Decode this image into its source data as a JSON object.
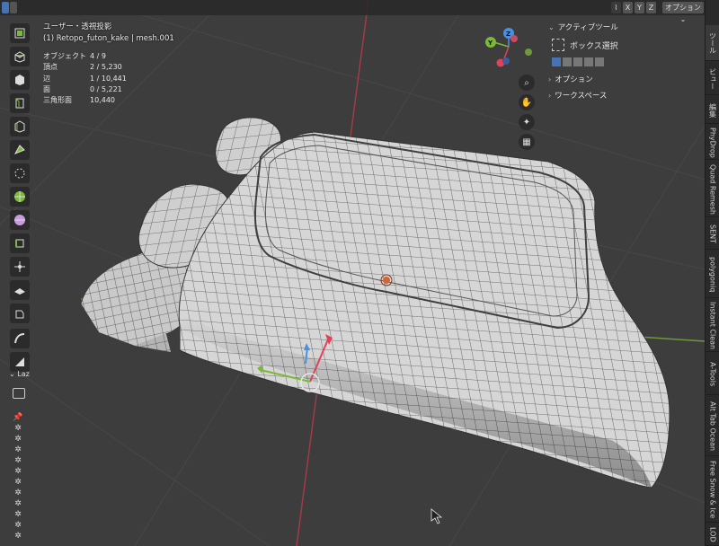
{
  "header": {
    "axis_buttons": [
      "X",
      "Y",
      "Z"
    ],
    "options_label": "オプション ⌄"
  },
  "overlay": {
    "view_name": "ユーザー・透視投影",
    "object_name": "(1) Retopo_futon_kake | mesh.001",
    "stats": [
      {
        "key": "オブジェクト",
        "value": "4 / 9"
      },
      {
        "key": "頂点",
        "value": "2 / 5,230"
      },
      {
        "key": "辺",
        "value": "1 / 10,441"
      },
      {
        "key": "面",
        "value": "0 / 5,221"
      },
      {
        "key": "三角形面",
        "value": "10,440"
      }
    ]
  },
  "npanel": {
    "active_tool_label": "アクティブツール",
    "active_tool_name": "ボックス選択",
    "options_label": "オプション",
    "workspace_label": "ワークスペース"
  },
  "left_panel": {
    "laz_label": "Laz"
  },
  "tabs": [
    "ツール",
    "ビュー",
    "編集",
    "PhyDrop",
    "Quad Remesh",
    "SENT",
    "polygoniq",
    "Instant Clean",
    "A-Tools",
    "Alt Tab Ocean",
    "Free Snow & Ice",
    "LOD"
  ],
  "colors": {
    "background": "#3d3d3d",
    "accent": "#4772b3",
    "x_axis": "#e3415a",
    "y_axis": "#7cb83a",
    "z_axis": "#4a90e2"
  }
}
